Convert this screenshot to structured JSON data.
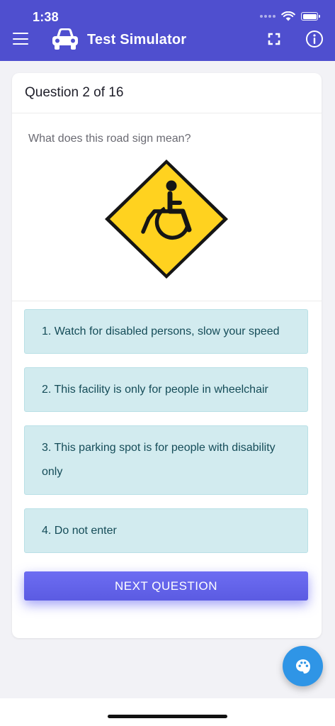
{
  "status_bar": {
    "time": "1:38"
  },
  "app_bar": {
    "title": "Test Simulator",
    "icons": [
      "menu-icon",
      "car-icon",
      "fullscreen-icon",
      "info-icon"
    ]
  },
  "quiz": {
    "counter": "Question 2 of 16",
    "question": "What does this road sign mean?",
    "sign": "disabled-persons-sign",
    "options": [
      {
        "label": "1. Watch for disabled persons, slow your speed"
      },
      {
        "label": "2. This facility is only for people in wheelchair"
      },
      {
        "label": "3. This parking spot is for people with disability only"
      },
      {
        "label": "4. Do not enter"
      }
    ],
    "next_label": "NEXT QUESTION"
  },
  "fab": {
    "icon": "palette-icon"
  },
  "colors": {
    "app_bar": "#4f4fcf",
    "option_bg": "#d2ebef",
    "option_text": "#154c58",
    "button": "#5b5be2",
    "fab": "#2f95e6",
    "sign_yellow": "#ffd21f"
  }
}
